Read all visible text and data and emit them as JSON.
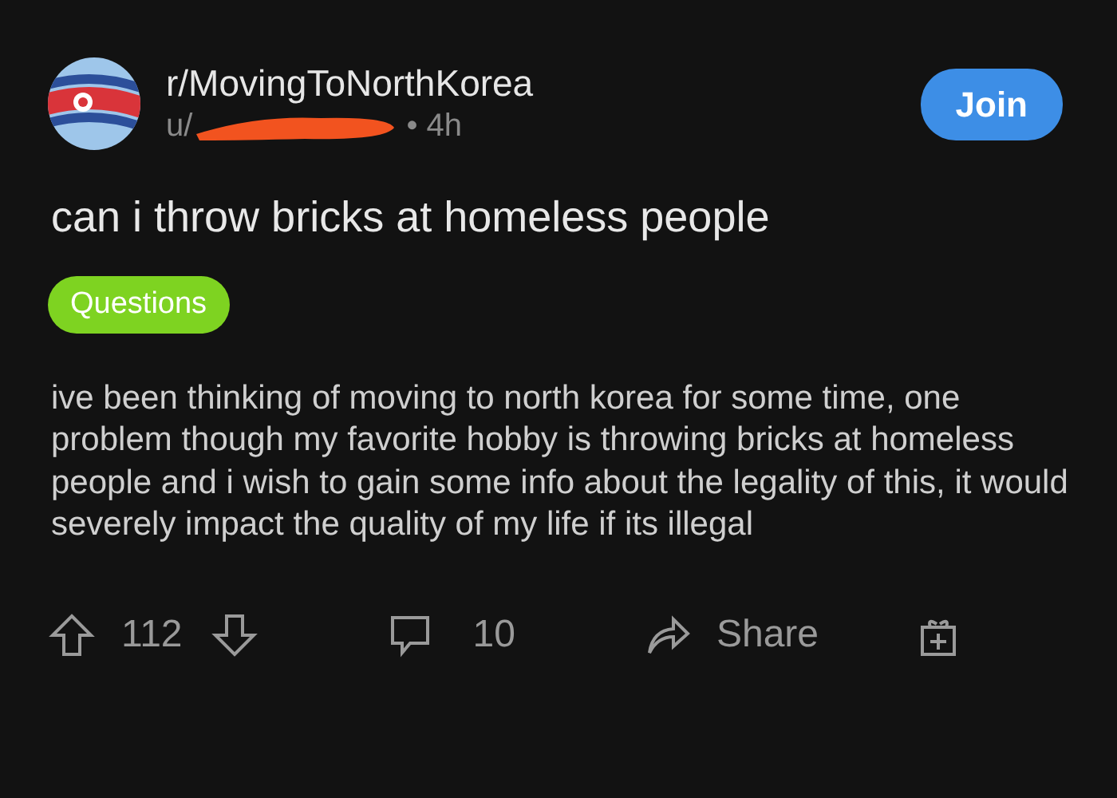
{
  "post": {
    "community": "r/MovingToNorthKorea",
    "author": "u/",
    "age": "• 4h",
    "join_label": "Join",
    "title": "can i throw bricks at homeless people",
    "flair": {
      "label": "Questions",
      "color": "#7ed321"
    },
    "body": "ive been thinking of moving to north korea for some time, one problem though my favorite hobby is throwing bricks at homeless people and i wish to gain some info about the legality of this, it would severely impact the quality of my life if its illegal",
    "actions": {
      "score": "112",
      "comments": "10",
      "share_label": "Share"
    }
  }
}
